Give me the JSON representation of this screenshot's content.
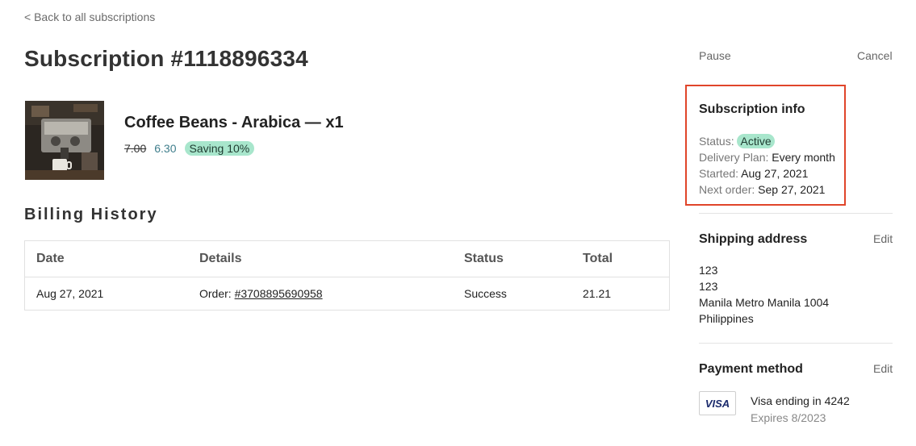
{
  "nav": {
    "back_label": "< Back to all subscriptions"
  },
  "page": {
    "title": "Subscription #1118896334"
  },
  "product": {
    "name": "Coffee Beans - Arabica — x1",
    "price_old": "7.00",
    "price_new": "6.30",
    "saving": "Saving 10%"
  },
  "billing": {
    "heading": "Billing History",
    "columns": [
      "Date",
      "Details",
      "Status",
      "Total"
    ],
    "rows": [
      {
        "date": "Aug 27, 2021",
        "details_prefix": "Order: ",
        "order_number": "#3708895690958",
        "status": "Success",
        "total": "21.21"
      }
    ]
  },
  "actions": {
    "pause_label": "Pause",
    "cancel_label": "Cancel"
  },
  "subscription_info": {
    "title": "Subscription info",
    "status_label": "Status:",
    "status_value": "Active",
    "plan_label": "Delivery Plan:",
    "plan_value": "Every month",
    "started_label": "Started:",
    "started_value": "Aug 27, 2021",
    "next_label": "Next order:",
    "next_value": "Sep 27, 2021"
  },
  "shipping": {
    "title": "Shipping address",
    "edit_label": "Edit",
    "lines": [
      "123",
      "123",
      "Manila Metro Manila 1004",
      "Philippines"
    ]
  },
  "payment": {
    "title": "Payment method",
    "edit_label": "Edit",
    "card_brand": "VISA",
    "card_text": "Visa ending in 4242",
    "expiry": "Expires 8/2023"
  },
  "colors": {
    "accent_badge": "#a8e6cc",
    "highlight_border": "#e0452a",
    "price_new": "#3f7e8c"
  }
}
